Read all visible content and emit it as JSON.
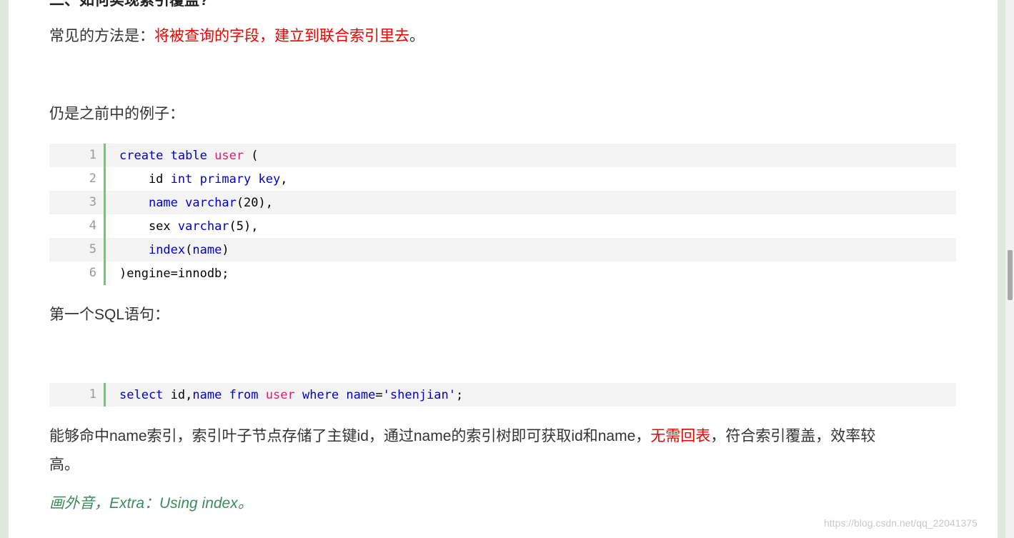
{
  "heading": "二、如何实现索引覆盖?",
  "para1": {
    "prefix": "常见的方法是：",
    "highlight": "将被查询的字段，建立到联合索引里去",
    "suffix": "。"
  },
  "para2": "仍是之前中的例子：",
  "code_block_1": {
    "lines": [
      {
        "num": "1",
        "tokens": [
          {
            "t": "create",
            "c": "kw"
          },
          {
            "t": " "
          },
          {
            "t": "table",
            "c": "kw"
          },
          {
            "t": " "
          },
          {
            "t": "user",
            "c": "tb"
          },
          {
            "t": " ("
          }
        ]
      },
      {
        "num": "2",
        "tokens": [
          {
            "t": "    id "
          },
          {
            "t": "int",
            "c": "kw"
          },
          {
            "t": " "
          },
          {
            "t": "primary",
            "c": "kw"
          },
          {
            "t": " "
          },
          {
            "t": "key",
            "c": "kw"
          },
          {
            "t": ","
          }
        ]
      },
      {
        "num": "3",
        "tokens": [
          {
            "t": "    "
          },
          {
            "t": "name",
            "c": "kw"
          },
          {
            "t": " "
          },
          {
            "t": "varchar",
            "c": "kw"
          },
          {
            "t": "(20),"
          }
        ]
      },
      {
        "num": "4",
        "tokens": [
          {
            "t": "    sex "
          },
          {
            "t": "varchar",
            "c": "kw"
          },
          {
            "t": "(5),"
          }
        ]
      },
      {
        "num": "5",
        "tokens": [
          {
            "t": "    "
          },
          {
            "t": "index",
            "c": "kw"
          },
          {
            "t": "("
          },
          {
            "t": "name",
            "c": "kw"
          },
          {
            "t": ")"
          }
        ]
      },
      {
        "num": "6",
        "tokens": [
          {
            "t": ")engine=innodb;"
          }
        ]
      }
    ]
  },
  "para3": "第一个SQL语句：",
  "code_block_2": {
    "lines": [
      {
        "num": "1",
        "tokens": [
          {
            "t": "select",
            "c": "kw"
          },
          {
            "t": " id,"
          },
          {
            "t": "name",
            "c": "kw"
          },
          {
            "t": " "
          },
          {
            "t": "from",
            "c": "kw"
          },
          {
            "t": " "
          },
          {
            "t": "user",
            "c": "tb"
          },
          {
            "t": " "
          },
          {
            "t": "where",
            "c": "kw"
          },
          {
            "t": " "
          },
          {
            "t": "name",
            "c": "kw"
          },
          {
            "t": "="
          },
          {
            "t": "'shenjian'",
            "c": "str"
          },
          {
            "t": ";"
          }
        ]
      }
    ]
  },
  "para4": {
    "prefix": "能够命中name索引，索引叶子节点存储了主键id，通过name的索引树即可获取id和name，",
    "highlight": "无需回表",
    "suffix": "，符合索引覆盖，效率较",
    "line2": "高。"
  },
  "para5": "画外音，Extra：Using index。",
  "watermark": "https://blog.csdn.net/qq_22041375"
}
